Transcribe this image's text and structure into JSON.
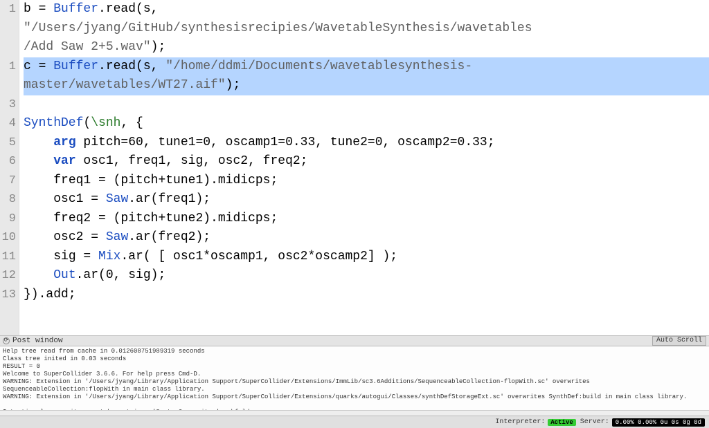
{
  "editor": {
    "gutter_numbers": [
      "1",
      "",
      "",
      "1",
      "",
      "3",
      "4",
      "5",
      "6",
      "7",
      "8",
      "9",
      "10",
      "11",
      "12",
      "13",
      ""
    ],
    "lines": [
      {
        "highlight": false,
        "spans": [
          {
            "cls": "tok-ident",
            "t": "b = "
          },
          {
            "cls": "tok-class",
            "t": "Buffer"
          },
          {
            "cls": "tok-ident",
            "t": ".read(s,"
          }
        ]
      },
      {
        "highlight": false,
        "spans": [
          {
            "cls": "tok-str",
            "t": "\"/Users/jyang/GitHub/synthesisrecipies/WavetableSynthesis/wavetables"
          }
        ]
      },
      {
        "highlight": false,
        "spans": [
          {
            "cls": "tok-str",
            "t": "/Add Saw 2+5.wav\""
          },
          {
            "cls": "tok-ident",
            "t": ");"
          }
        ]
      },
      {
        "highlight": true,
        "spans": [
          {
            "cls": "tok-ident",
            "t": "c = "
          },
          {
            "cls": "tok-class",
            "t": "Buffer"
          },
          {
            "cls": "tok-ident",
            "t": ".read(s, "
          },
          {
            "cls": "tok-str",
            "t": "\"/home/ddmi/Documents/wavetablesynthesis-"
          }
        ]
      },
      {
        "highlight": true,
        "spans": [
          {
            "cls": "tok-str",
            "t": "master/wavetables/WT27.aif\""
          },
          {
            "cls": "tok-ident",
            "t": ");"
          }
        ]
      },
      {
        "highlight": false,
        "spans": [
          {
            "cls": "tok-ident",
            "t": ""
          }
        ]
      },
      {
        "highlight": false,
        "spans": [
          {
            "cls": "tok-class",
            "t": "SynthDef"
          },
          {
            "cls": "tok-ident",
            "t": "("
          },
          {
            "cls": "tok-sym",
            "t": "\\snh"
          },
          {
            "cls": "tok-ident",
            "t": ", {"
          }
        ]
      },
      {
        "highlight": false,
        "spans": [
          {
            "cls": "tok-ident",
            "t": "    "
          },
          {
            "cls": "tok-kw",
            "t": "arg"
          },
          {
            "cls": "tok-ident",
            "t": " pitch=60, tune1=0, oscamp1=0.33, tune2=0, oscamp2=0.33;"
          }
        ]
      },
      {
        "highlight": false,
        "spans": [
          {
            "cls": "tok-ident",
            "t": "    "
          },
          {
            "cls": "tok-kw",
            "t": "var"
          },
          {
            "cls": "tok-ident",
            "t": " osc1, freq1, sig, osc2, freq2;"
          }
        ]
      },
      {
        "highlight": false,
        "spans": [
          {
            "cls": "tok-ident",
            "t": "    freq1 = (pitch+tune1).midicps;"
          }
        ]
      },
      {
        "highlight": false,
        "spans": [
          {
            "cls": "tok-ident",
            "t": "    osc1 = "
          },
          {
            "cls": "tok-class",
            "t": "Saw"
          },
          {
            "cls": "tok-ident",
            "t": ".ar(freq1);"
          }
        ]
      },
      {
        "highlight": false,
        "spans": [
          {
            "cls": "tok-ident",
            "t": "    freq2 = (pitch+tune2).midicps;"
          }
        ]
      },
      {
        "highlight": false,
        "spans": [
          {
            "cls": "tok-ident",
            "t": "    osc2 = "
          },
          {
            "cls": "tok-class",
            "t": "Saw"
          },
          {
            "cls": "tok-ident",
            "t": ".ar(freq2);"
          }
        ]
      },
      {
        "highlight": false,
        "spans": [
          {
            "cls": "tok-ident",
            "t": "    sig = "
          },
          {
            "cls": "tok-class",
            "t": "Mix"
          },
          {
            "cls": "tok-ident",
            "t": ".ar( [ osc1*oscamp1, osc2*oscamp2] );"
          }
        ]
      },
      {
        "highlight": false,
        "spans": [
          {
            "cls": "tok-ident",
            "t": "    "
          },
          {
            "cls": "tok-class",
            "t": "Out"
          },
          {
            "cls": "tok-ident",
            "t": ".ar(0, sig);"
          }
        ]
      },
      {
        "highlight": false,
        "spans": [
          {
            "cls": "tok-ident",
            "t": "}).add;"
          }
        ]
      },
      {
        "highlight": false,
        "spans": [
          {
            "cls": "tok-ident",
            "t": ""
          }
        ]
      }
    ]
  },
  "post_header": {
    "title": "Post window",
    "autoscroll": "Auto Scroll"
  },
  "post_window_text": "Help tree read from cache in 0.012608751989319 seconds\nClass tree inited in 0.03 seconds\nRESULT = 0\nWelcome to SuperCollider 3.6.6. For help press Cmd-D.\nWARNING: Extension in '/Users/jyang/Library/Application Support/SuperCollider/Extensions/ImmLib/sc3.6Additions/SequenceableCollection-flopWith.sc' overwrites SequenceableCollection:flopWith in main class library.\nWARNING: Extension in '/Users/jyang/Library/Application Support/SuperCollider/Extensions/quarks/autogui/Classes/synthDefStorageExt.sc' overwrites SynthDef:build in main class library.\n\nIntentional overwrites must be put in a 'SystemOverwrites' subfolder.",
  "status": {
    "interpreter_label": "Interpreter:",
    "interpreter_state": "Active",
    "server_label": "Server:",
    "metrics": "0.00% 0.00%   0u   0s   0g   0d"
  }
}
